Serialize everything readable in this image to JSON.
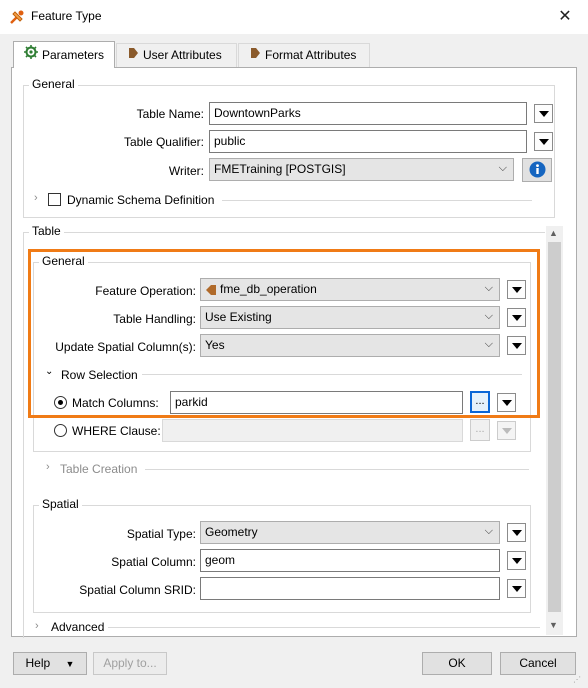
{
  "window": {
    "title": "Feature Type",
    "close_glyph": "✕"
  },
  "tabs": [
    {
      "label": "Parameters",
      "icon": "gear-icon",
      "active": true
    },
    {
      "label": "User Attributes",
      "icon": "arrow-tag-icon",
      "active": false
    },
    {
      "label": "Format Attributes",
      "icon": "arrow-tag-icon",
      "active": false
    }
  ],
  "general": {
    "title": "General",
    "table_name_label": "Table Name:",
    "table_name_value": "DowntownParks",
    "table_qualifier_label": "Table Qualifier:",
    "table_qualifier_value": "public",
    "writer_label": "Writer:",
    "writer_value": "FMETraining [POSTGIS]",
    "dynamic_schema_label": "Dynamic Schema Definition"
  },
  "table": {
    "title": "Table",
    "general_title": "General",
    "feature_operation_label": "Feature Operation:",
    "feature_operation_value": "fme_db_operation",
    "table_handling_label": "Table Handling:",
    "table_handling_value": "Use Existing",
    "update_spatial_label": "Update Spatial Column(s):",
    "update_spatial_value": "Yes",
    "row_selection_label": "Row Selection",
    "match_columns_label": "Match Columns:",
    "match_columns_value": "parkid",
    "ellipsis": "...",
    "where_clause_label": "WHERE Clause:",
    "table_creation_label": "Table Creation"
  },
  "spatial": {
    "title": "Spatial",
    "spatial_type_label": "Spatial Type:",
    "spatial_type_value": "Geometry",
    "spatial_column_label": "Spatial Column:",
    "spatial_column_value": "geom",
    "spatial_srid_label": "Spatial Column SRID:",
    "spatial_srid_value": ""
  },
  "advanced_label": "Advanced",
  "footer": {
    "help": "Help",
    "apply": "Apply to...",
    "ok": "OK",
    "cancel": "Cancel"
  },
  "colors": {
    "highlight": "#f07b16",
    "info": "#1565c0"
  }
}
